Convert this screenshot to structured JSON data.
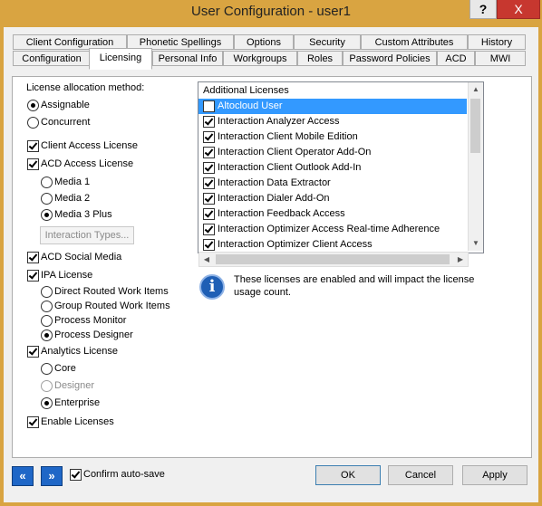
{
  "window": {
    "title": "User Configuration - user1",
    "help": "?",
    "close": "X"
  },
  "tabs_row1": [
    "Client Configuration",
    "Phonetic Spellings",
    "Options",
    "Security",
    "Custom Attributes",
    "History"
  ],
  "tabs_row2": [
    "Configuration",
    "Licensing",
    "Personal Info",
    "Workgroups",
    "Roles",
    "Password Policies",
    "ACD",
    "MWI"
  ],
  "active_tab": "Licensing",
  "license": {
    "method_label": "License allocation method:",
    "assignable": "Assignable",
    "concurrent": "Concurrent",
    "client_access": "Client Access License",
    "acd_access": "ACD Access License",
    "media1": "Media 1",
    "media2": "Media 2",
    "media3": "Media 3 Plus",
    "interaction_types": "Interaction Types...",
    "acd_social": "ACD Social Media",
    "ipa": "IPA License",
    "direct_routed": "Direct Routed Work Items",
    "group_routed": "Group Routed Work Items",
    "process_monitor": "Process Monitor",
    "process_designer": "Process Designer",
    "analytics": "Analytics License",
    "core": "Core",
    "designer": "Designer",
    "enterprise": "Enterprise",
    "enable_licenses": "Enable Licenses"
  },
  "additional": {
    "header": "Additional Licenses",
    "items": [
      {
        "label": "Altocloud User",
        "checked": false
      },
      {
        "label": "Interaction Analyzer Access",
        "checked": true
      },
      {
        "label": "Interaction Client Mobile Edition",
        "checked": true
      },
      {
        "label": "Interaction Client Operator Add-On",
        "checked": true
      },
      {
        "label": "Interaction Client Outlook Add-In",
        "checked": true
      },
      {
        "label": "Interaction Data Extractor",
        "checked": true
      },
      {
        "label": "Interaction Dialer Add-On",
        "checked": true
      },
      {
        "label": "Interaction Feedback Access",
        "checked": true
      },
      {
        "label": "Interaction Optimizer Access Real-time Adherence",
        "checked": true
      },
      {
        "label": "Interaction Optimizer Client Access",
        "checked": true
      }
    ]
  },
  "info": {
    "line1": "These licenses are enabled and will impact the license",
    "line2": "usage count."
  },
  "footer": {
    "confirm": "Confirm auto-save",
    "ok": "OK",
    "cancel": "Cancel",
    "apply": "Apply"
  },
  "colors": {
    "titlebar": "#d9a441",
    "selection": "#3399ff",
    "close": "#c7372f",
    "nav": "#1f67c7"
  }
}
